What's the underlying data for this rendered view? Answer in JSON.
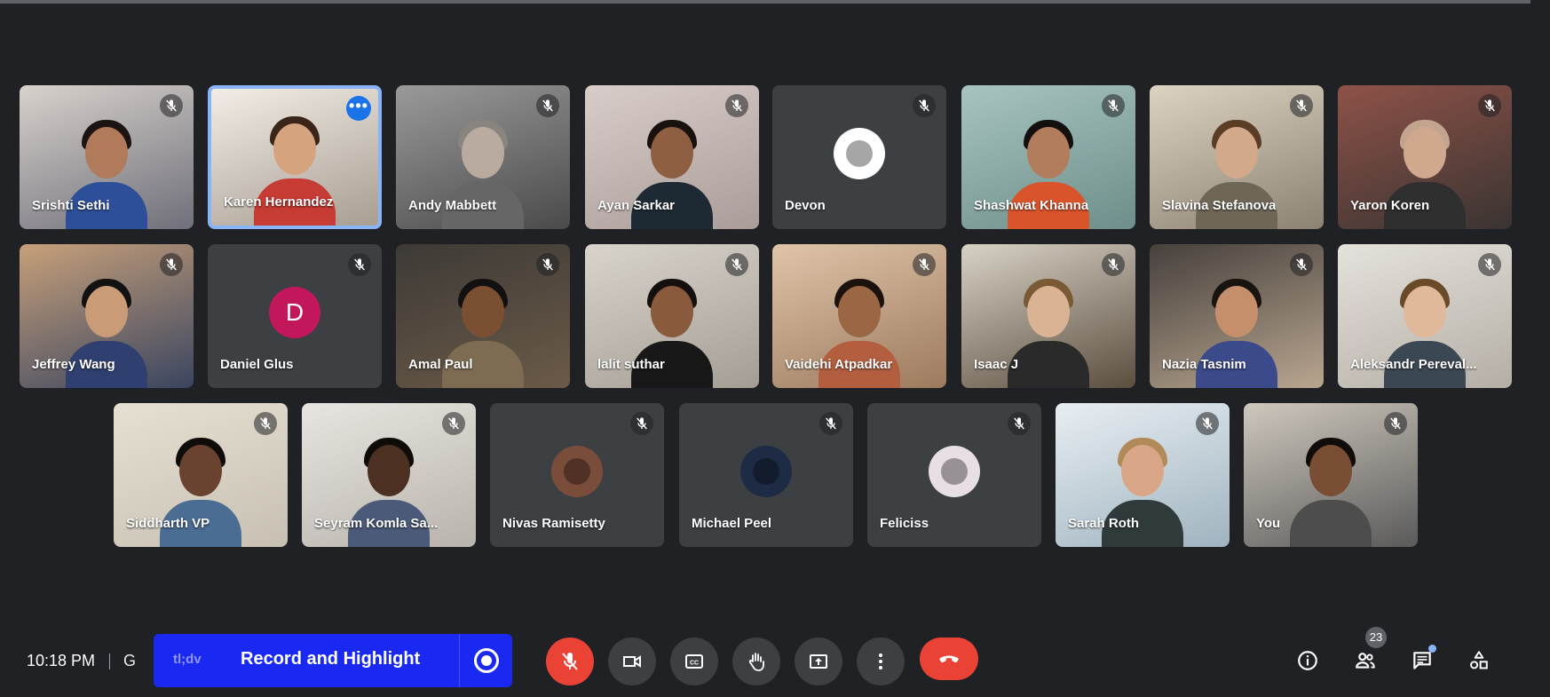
{
  "meeting": {
    "time": "10:18 PM",
    "meeting_code_partial": "G",
    "people_count": "23"
  },
  "tldv": {
    "logo": "tl;dv",
    "label": "Record and Highlight"
  },
  "participants": [
    {
      "name": "Srishti Sethi",
      "type": "video",
      "c1": "#d8d2cc",
      "c2": "#6f6f7a",
      "skin": "#b07a5b",
      "hair": "#1c1412",
      "shirt": "#2d4f9a"
    },
    {
      "name": "Karen Hernandez",
      "type": "video",
      "active": true,
      "c1": "#f2ede6",
      "c2": "#a89e92",
      "skin": "#d6a37f",
      "hair": "#3a2518",
      "shirt": "#c63b33"
    },
    {
      "name": "Andy Mabbett",
      "type": "video",
      "c1": "#9a9a9a",
      "c2": "#4a4a4a",
      "skin": "#b9aba0",
      "hair": "#8a847e",
      "shirt": "#666"
    },
    {
      "name": "Ayan Sarkar",
      "type": "video",
      "c1": "#d9cdc9",
      "c2": "#a99c99",
      "skin": "#8f5f42",
      "hair": "#18110e",
      "shirt": "#1e2a33"
    },
    {
      "name": "Devon",
      "type": "avatar",
      "avatar_icon": "chess-piece-avatar",
      "avatar_bg": "#ffffff"
    },
    {
      "name": "Shashwat Khanna",
      "type": "video",
      "c1": "#a8c4bf",
      "c2": "#6d8e8a",
      "skin": "#b17d5c",
      "hair": "#151010",
      "shirt": "#d9542b"
    },
    {
      "name": "Slavina Stefanova",
      "type": "video",
      "c1": "#dcd3c2",
      "c2": "#8c8273",
      "skin": "#d3a98c",
      "hair": "#5b3c25",
      "shirt": "#6e6758"
    },
    {
      "name": "Yaron Koren",
      "type": "video",
      "c1": "#8e5248",
      "c2": "#3a3432",
      "skin": "#cfa88e",
      "hair": "#c3a58f",
      "shirt": "#2f2f2f"
    },
    {
      "name": "Jeffrey Wang",
      "type": "video",
      "c1": "#c7a07a",
      "c2": "#3a4560",
      "skin": "#c99b77",
      "hair": "#121212",
      "shirt": "#2f3f70"
    },
    {
      "name": "Daniel Glus",
      "type": "avatar",
      "avatar_letter": "D",
      "avatar_bg": "#c2185b"
    },
    {
      "name": "Amal Paul",
      "type": "video",
      "c1": "#3d3a36",
      "c2": "#6b5a48",
      "skin": "#7a4f32",
      "hair": "#121010",
      "shirt": "#7d6b52"
    },
    {
      "name": "lalit suthar",
      "type": "video",
      "c1": "#d9d4cc",
      "c2": "#a49d94",
      "skin": "#8a5a3c",
      "hair": "#151010",
      "shirt": "#181818"
    },
    {
      "name": "Vaidehi Atpadkar",
      "type": "video",
      "c1": "#e0c4a9",
      "c2": "#9c7a5e",
      "skin": "#9a6644",
      "hair": "#1b120e",
      "shirt": "#b35f3f"
    },
    {
      "name": "Isaac J",
      "type": "video",
      "c1": "#d8d2c6",
      "c2": "#5b4e3f",
      "skin": "#d9b393",
      "hair": "#7a5a35",
      "shirt": "#2a2a2a"
    },
    {
      "name": "Nazia Tasnim",
      "type": "video",
      "c1": "#46403c",
      "c2": "#b9a690",
      "skin": "#c68f6c",
      "hair": "#1a1410",
      "shirt": "#3a4a8a"
    },
    {
      "name": "Aleksandr Pereval...",
      "type": "video",
      "c1": "#e5e2dc",
      "c2": "#b4aea5",
      "skin": "#e0b89a",
      "hair": "#6b4a2a",
      "shirt": "#3b4752"
    },
    {
      "name": "Siddharth VP",
      "type": "video",
      "c1": "#e6e0d3",
      "c2": "#c7c0b2",
      "skin": "#6a4330",
      "hair": "#0f0c0a",
      "shirt": "#4b6d94"
    },
    {
      "name": "Seyram Komla Sa...",
      "type": "video",
      "c1": "#e8e5e0",
      "c2": "#b8b3ac",
      "skin": "#4c3122",
      "hair": "#0f0b09",
      "shirt": "#4a5a78"
    },
    {
      "name": "Nivas Ramisetty",
      "type": "avatar",
      "avatar_icon": "photo-avatar",
      "avatar_bg": "#7a4d3a"
    },
    {
      "name": "Michael Peel",
      "type": "avatar",
      "avatar_icon": "photo-avatar",
      "avatar_bg": "#1d2c44"
    },
    {
      "name": "Feliciss",
      "type": "avatar",
      "avatar_icon": "anime-avatar",
      "avatar_bg": "#e8dfe6"
    },
    {
      "name": "Sarah Roth",
      "type": "video",
      "c1": "#e8eef2",
      "c2": "#9fb3bf",
      "skin": "#d9a787",
      "hair": "#b08a58",
      "shirt": "#2f3a3a"
    },
    {
      "name": "You",
      "type": "video",
      "c1": "#cfc8bd",
      "c2": "#5a5a5a",
      "skin": "#7a4e35",
      "hair": "#100c0a",
      "shirt": "#4d4d4d"
    }
  ],
  "controls": {
    "mic": "mic-off-icon",
    "camera": "camera-icon",
    "captions": "captions-icon",
    "raise_hand": "raise-hand-icon",
    "present": "present-icon",
    "more": "more-vert-icon",
    "leave": "end-call-icon",
    "info": "info-icon",
    "people": "people-icon",
    "chat": "chat-icon",
    "activities": "activities-icon"
  }
}
